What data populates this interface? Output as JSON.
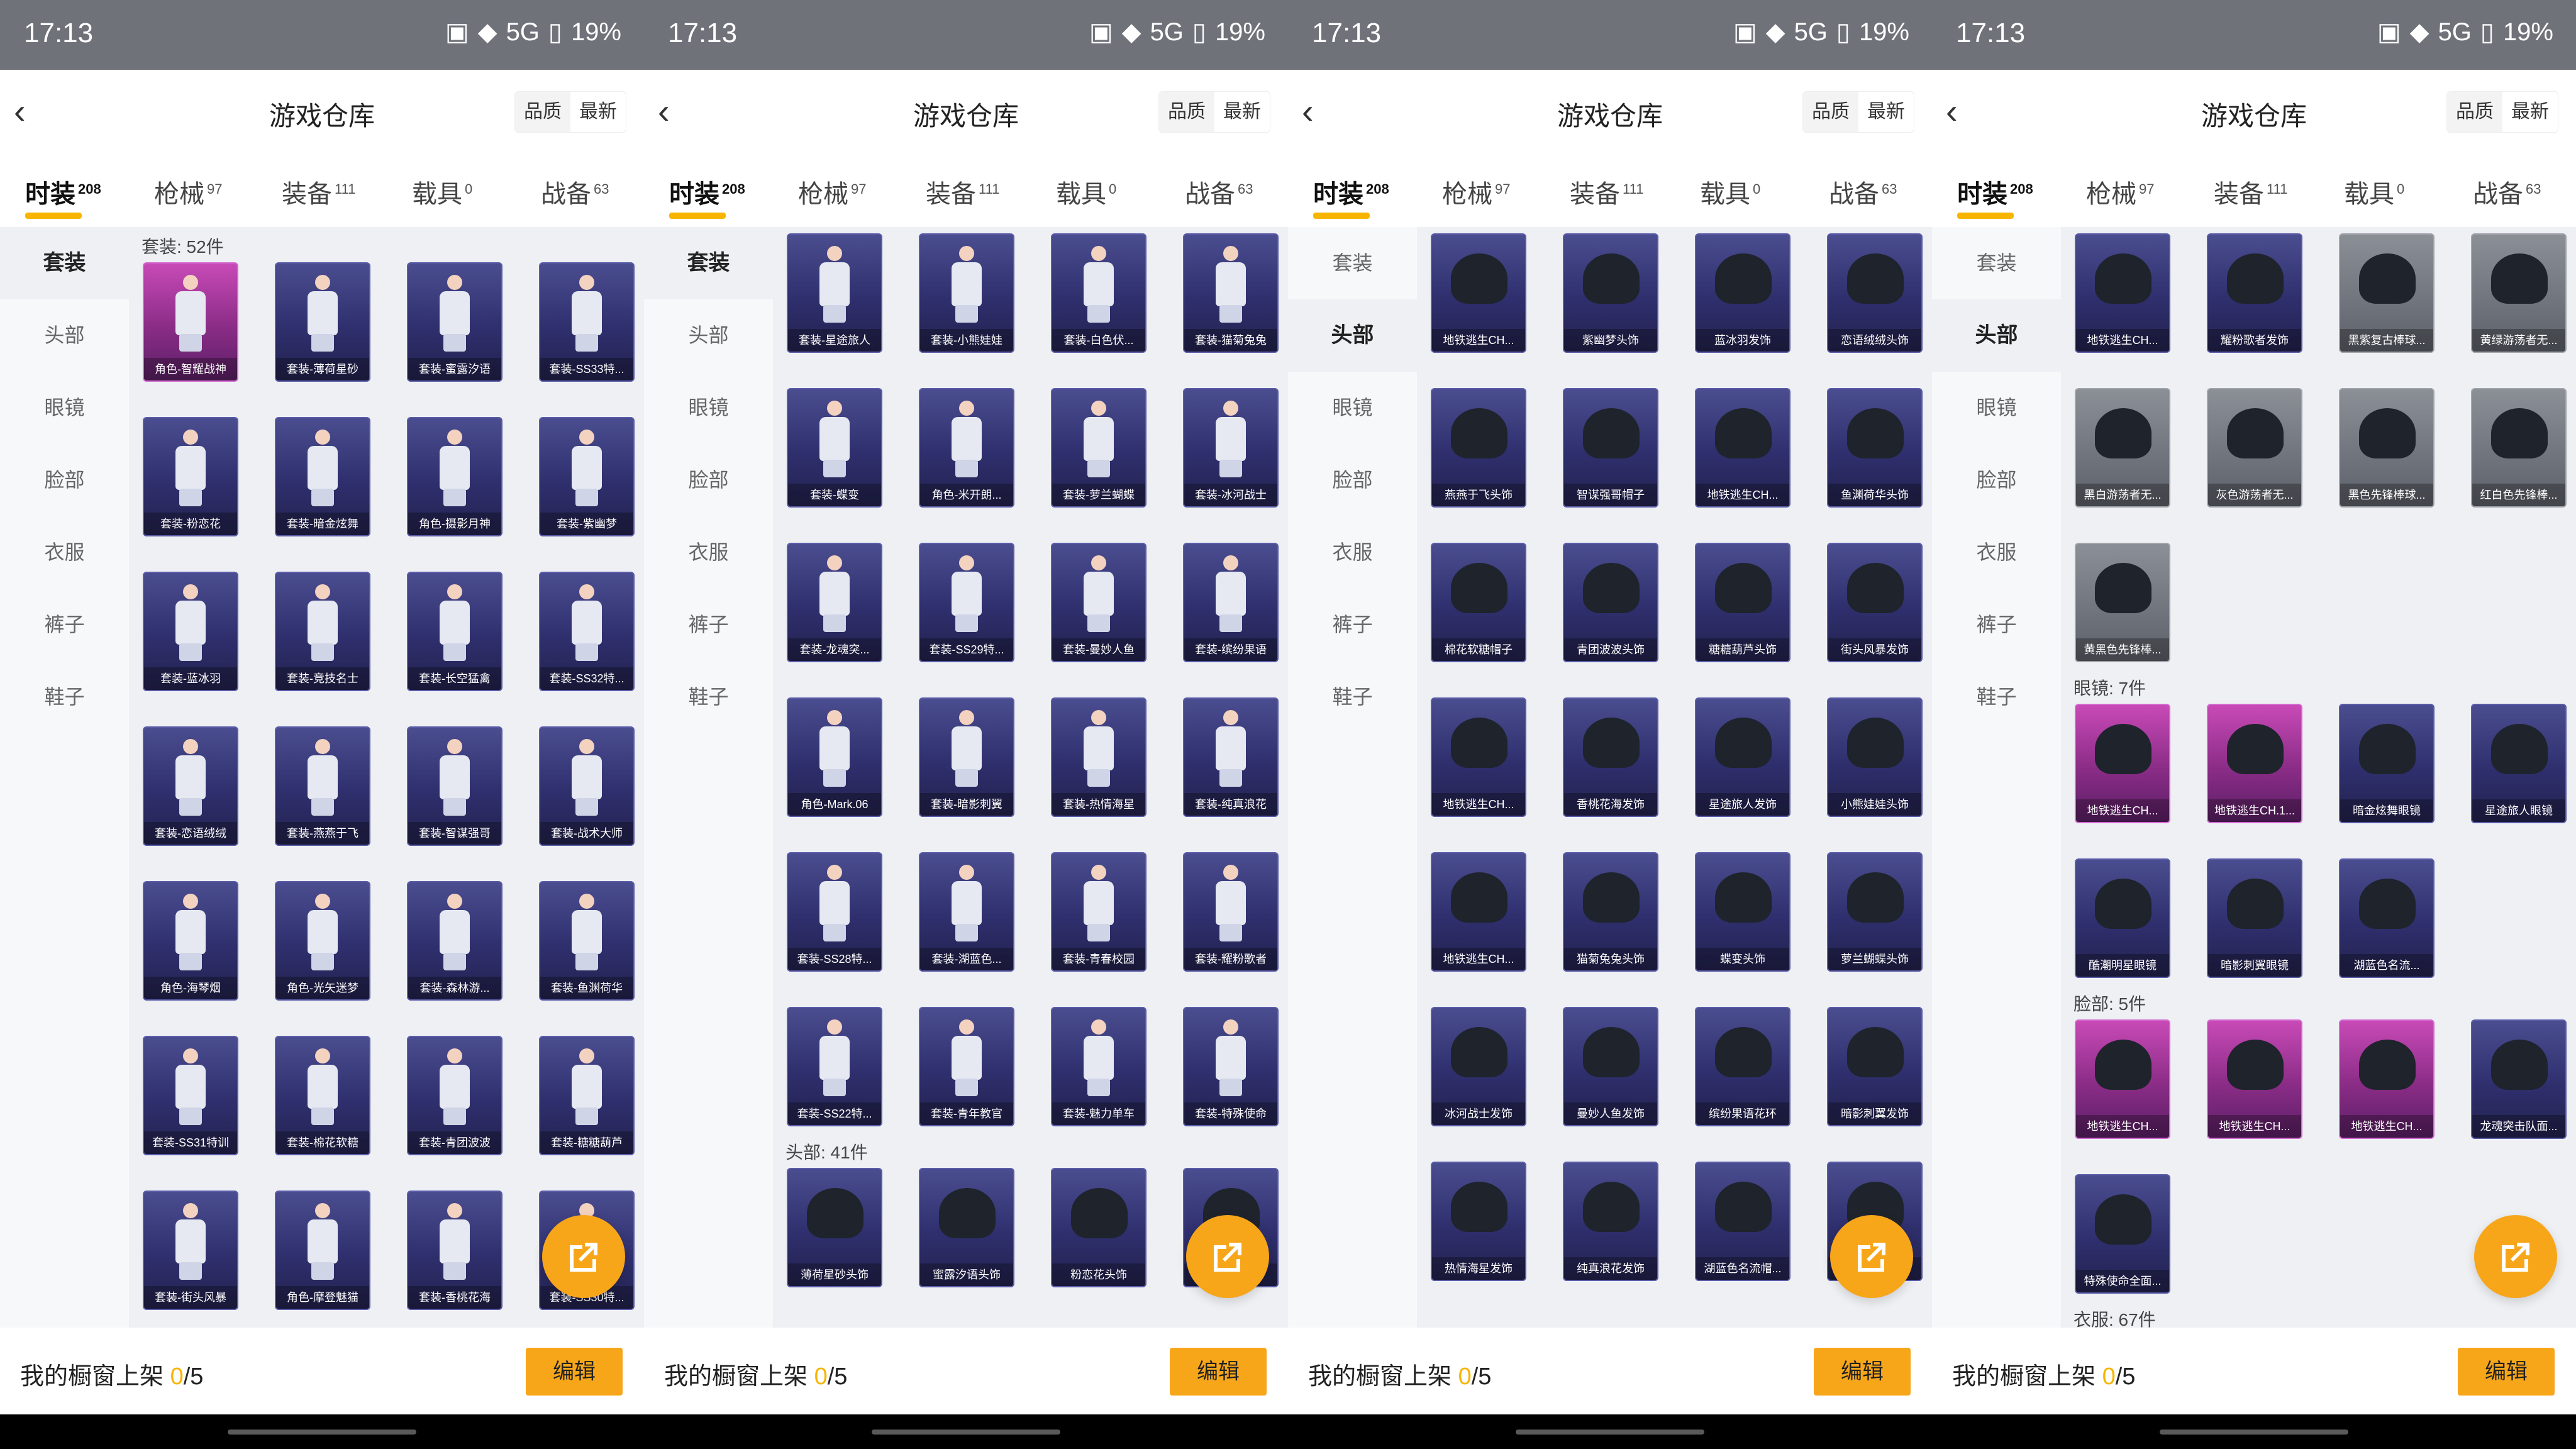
{
  "status": {
    "time": "17:13",
    "battery": "19%",
    "network": "5G"
  },
  "page": {
    "title": "游戏仓库"
  },
  "sort": {
    "quality_label": "品质",
    "newest_label": "最新"
  },
  "tabs": [
    {
      "label": "时装",
      "count": "208"
    },
    {
      "label": "枪械",
      "count": "97"
    },
    {
      "label": "装备",
      "count": "111"
    },
    {
      "label": "载具",
      "count": "0"
    },
    {
      "label": "战备",
      "count": "63"
    }
  ],
  "sidebar": [
    "套装",
    "头部",
    "眼镜",
    "脸部",
    "衣服",
    "裤子",
    "鞋子"
  ],
  "footer": {
    "text_prefix": "我的橱窗上架",
    "current": "0",
    "total": "/5",
    "edit_label": "编辑"
  },
  "panels": [
    {
      "active_side": 0,
      "sections": [
        {
          "title": "套装: 52件",
          "items": [
            {
              "label": "角色-智耀战神",
              "color": "pink"
            },
            {
              "label": "套装-薄荷星砂"
            },
            {
              "label": "套装-蜜露汐语"
            },
            {
              "label": "套装-SS33特..."
            },
            {
              "label": "套装-粉恋花"
            },
            {
              "label": "套装-暗金炫舞"
            },
            {
              "label": "角色-摄影月神"
            },
            {
              "label": "套装-紫幽梦"
            },
            {
              "label": "套装-蓝冰羽"
            },
            {
              "label": "套装-竞技名士"
            },
            {
              "label": "套装-长空猛禽"
            },
            {
              "label": "套装-SS32特..."
            },
            {
              "label": "套装-恋语绒绒"
            },
            {
              "label": "套装-燕燕于飞"
            },
            {
              "label": "套装-智谋强哥"
            },
            {
              "label": "套装-战术大师"
            },
            {
              "label": "角色-海琴烟"
            },
            {
              "label": "角色-光矢迷梦"
            },
            {
              "label": "套装-森林游..."
            },
            {
              "label": "套装-鱼渊荷华"
            },
            {
              "label": "套装-SS31特训"
            },
            {
              "label": "套装-棉花软糖"
            },
            {
              "label": "套装-青团波波"
            },
            {
              "label": "套装-糖糖葫芦"
            },
            {
              "label": "套装-街头风暴"
            },
            {
              "label": "角色-摩登魅猫"
            },
            {
              "label": "套装-香桃花海"
            },
            {
              "label": "套装-SS30特..."
            }
          ]
        }
      ]
    },
    {
      "active_side": 0,
      "sections": [
        {
          "title": "",
          "items": [
            {
              "label": "套装-星途旅人"
            },
            {
              "label": "套装-小熊娃娃"
            },
            {
              "label": "套装-白色伏..."
            },
            {
              "label": "套装-猫菊兔兔"
            },
            {
              "label": "套装-蝶变"
            },
            {
              "label": "角色-米开朗..."
            },
            {
              "label": "套装-萝兰蝴蝶"
            },
            {
              "label": "套装-冰河战士"
            },
            {
              "label": "套装-龙魂突..."
            },
            {
              "label": "套装-SS29特..."
            },
            {
              "label": "套装-曼妙人鱼"
            },
            {
              "label": "套装-缤纷果语"
            },
            {
              "label": "角色-Mark.06"
            },
            {
              "label": "套装-暗影刺翼"
            },
            {
              "label": "套装-热情海星"
            },
            {
              "label": "套装-纯真浪花"
            },
            {
              "label": "套装-SS28特..."
            },
            {
              "label": "套装-湖蓝色..."
            },
            {
              "label": "套装-青春校园"
            },
            {
              "label": "套装-耀粉歌者"
            },
            {
              "label": "套装-SS22特..."
            },
            {
              "label": "套装-青年教官"
            },
            {
              "label": "套装-魅力单车"
            },
            {
              "label": "套装-特殊使命"
            }
          ]
        },
        {
          "title": "头部: 41件",
          "items": [
            {
              "label": "薄荷星砂头饰"
            },
            {
              "label": "蜜露汐语头饰"
            },
            {
              "label": "粉恋花头饰"
            },
            {
              "label": "...头饰"
            }
          ]
        }
      ]
    },
    {
      "active_side": 1,
      "sections": [
        {
          "title": "",
          "items": [
            {
              "label": "地铁逃生CH..."
            },
            {
              "label": "紫幽梦头饰"
            },
            {
              "label": "蓝冰羽发饰"
            },
            {
              "label": "恋语绒绒头饰"
            },
            {
              "label": "燕燕于飞头饰"
            },
            {
              "label": "智谋强哥帽子"
            },
            {
              "label": "地铁逃生CH..."
            },
            {
              "label": "鱼渊荷华头饰"
            },
            {
              "label": "棉花软糖帽子"
            },
            {
              "label": "青团波波头饰"
            },
            {
              "label": "糖糖葫芦头饰"
            },
            {
              "label": "街头风暴发饰"
            },
            {
              "label": "地铁逃生CH..."
            },
            {
              "label": "香桃花海发饰"
            },
            {
              "label": "星途旅人发饰"
            },
            {
              "label": "小熊娃娃头饰"
            },
            {
              "label": "地铁逃生CH..."
            },
            {
              "label": "猫菊兔兔头饰"
            },
            {
              "label": "蝶变头饰"
            },
            {
              "label": "萝兰蝴蝶头饰"
            },
            {
              "label": "冰河战士发饰"
            },
            {
              "label": "曼妙人鱼发饰"
            },
            {
              "label": "缤纷果语花环"
            },
            {
              "label": "暗影刺翼发饰"
            },
            {
              "label": "热情海星发饰"
            },
            {
              "label": "纯真浪花发饰"
            },
            {
              "label": "湖蓝色名流帽..."
            },
            {
              "label": "...头饰"
            }
          ]
        }
      ]
    },
    {
      "active_side": 1,
      "sections": [
        {
          "title": "",
          "items": [
            {
              "label": "地铁逃生CH..."
            },
            {
              "label": "耀粉歌者发饰"
            },
            {
              "label": "黑紫复古棒球...",
              "color": "gray"
            },
            {
              "label": "黄绿游荡者无...",
              "color": "gray"
            },
            {
              "label": "黑白游荡者无...",
              "color": "gray"
            },
            {
              "label": "灰色游荡者无...",
              "color": "gray"
            },
            {
              "label": "黑色先锋棒球...",
              "color": "gray"
            },
            {
              "label": "红白色先锋棒...",
              "color": "gray"
            },
            {
              "label": "黄黑色先锋棒...",
              "color": "gray"
            }
          ]
        },
        {
          "title": "眼镜: 7件",
          "items": [
            {
              "label": "地铁逃生CH...",
              "color": "pink"
            },
            {
              "label": "地铁逃生CH.1...",
              "color": "pink"
            },
            {
              "label": "暗金炫舞眼镜"
            },
            {
              "label": "星途旅人眼镜"
            },
            {
              "label": "酷潮明星眼镜"
            },
            {
              "label": "暗影刺翼眼镜"
            },
            {
              "label": "湖蓝色名流..."
            }
          ]
        },
        {
          "title": "脸部: 5件",
          "items": [
            {
              "label": "地铁逃生CH...",
              "color": "pink"
            },
            {
              "label": "地铁逃生CH...",
              "color": "pink"
            },
            {
              "label": "地铁逃生CH...",
              "color": "pink"
            },
            {
              "label": "龙魂突击队面..."
            },
            {
              "label": "特殊使命全面..."
            }
          ]
        },
        {
          "title": "衣服: 67件",
          "items": []
        }
      ]
    }
  ]
}
